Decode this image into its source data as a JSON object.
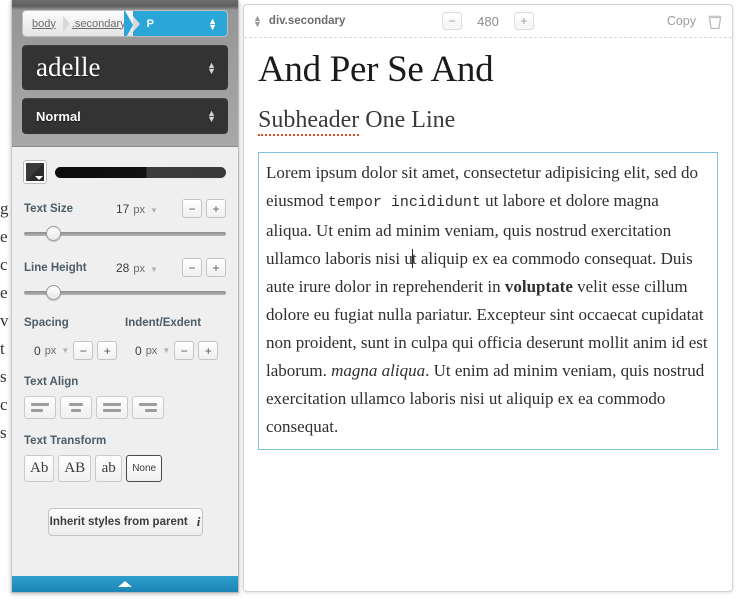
{
  "underlay_text": "g\ne\nc\ne\nv\nt\ns\nc\ns",
  "left_panel": {
    "breadcrumb": {
      "items": [
        {
          "label": "body",
          "active": false
        },
        {
          "label": ".secondary",
          "active": false
        },
        {
          "label": "P",
          "active": true
        }
      ],
      "stepper_icon": "chevron-up-down-icon"
    },
    "font_family": {
      "value": "adelle",
      "stepper_icon": "chevron-up-down-icon"
    },
    "font_weight": {
      "value": "Normal",
      "stepper_icon": "chevron-up-down-icon"
    },
    "color": {
      "swatch_icon": "color-swatch-icon",
      "swatch_color": "#333333",
      "gradient_from": "#0d0d0d",
      "gradient_to": "#3a3a3a"
    },
    "text_size": {
      "label": "Text Size",
      "value": "17",
      "unit": "px",
      "minus": "−",
      "plus": "+",
      "slider_percent": 13
    },
    "line_height": {
      "label": "Line Height",
      "value": "28",
      "unit": "px",
      "minus": "−",
      "plus": "+",
      "slider_percent": 13
    },
    "spacing": {
      "label": "Spacing",
      "value": "0",
      "unit": "px",
      "minus": "−",
      "plus": "+"
    },
    "indent": {
      "label": "Indent/Exdent",
      "value": "0",
      "unit": "px",
      "minus": "−",
      "plus": "+"
    },
    "text_align": {
      "label": "Text Align",
      "options": [
        "align-left",
        "align-center",
        "align-justify",
        "align-right"
      ]
    },
    "text_transform": {
      "label": "Text Transform",
      "options": [
        {
          "label": "Ab",
          "selected": false
        },
        {
          "label": "AB",
          "selected": false
        },
        {
          "label": "ab",
          "selected": false
        },
        {
          "label": "None",
          "selected": true
        }
      ]
    },
    "inherit_button": {
      "label": "Inherit styles from parent",
      "info_icon": "info-icon"
    },
    "footer": {
      "icon": "chevron-up-icon",
      "color": "#2489bb"
    }
  },
  "right_panel": {
    "header": {
      "stepper_icon": "chevron-up-down-icon",
      "title": "div.secondary",
      "width_minus": "−",
      "width_value": "480",
      "width_plus": "+",
      "copy_label": "Copy",
      "trash_icon": "trash-icon"
    },
    "document": {
      "heading": "And Per Se And",
      "subheader_spelled": "Subheader",
      "subheader_rest": " One Line",
      "paragraph": {
        "seg1": "Lorem ipsum dolor sit amet, consectetur adipisicing elit, sed do eiusmod ",
        "mono": "tempor incididunt",
        "seg2": " ut labore et dolore magna aliqua. Ut enim ad minim veniam, quis nostrud exercitation ullamco laboris nisi u",
        "seg3": "t aliquip ex ea commodo consequat. Duis aute irure dolor in reprehenderit in ",
        "bold": "voluptate",
        "seg4": " velit esse cillum dolore eu fugiat nulla pariatur. Excepteur sint occaecat cupidatat non proident, sunt in culpa qui officia deserunt mollit anim id est laborum. ",
        "italic": "magna aliqua",
        "seg5": ". Ut enim ad minim veniam, quis nostrud exercitation ullamco laboris nisi ut aliquip ex ea commodo consequat."
      }
    }
  }
}
